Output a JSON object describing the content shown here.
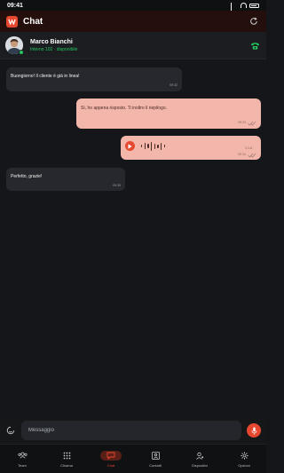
{
  "status_bar": {
    "time": "09:41"
  },
  "app_bar": {
    "title": "Chat"
  },
  "contact": {
    "name": "Marco Bianchi",
    "status": "Interno 102 · disponibile"
  },
  "messages": [
    {
      "direction": "in",
      "text": "Buongiorno! Il cliente è già in linea!",
      "time": "09:32"
    },
    {
      "direction": "out",
      "text": "Sì, ho appena risposto. Ti inoltro il riepilogo.",
      "time": "09:33"
    },
    {
      "direction": "out",
      "type": "voice",
      "duration": "0:18",
      "time": "09:34"
    },
    {
      "direction": "in",
      "text": "Perfetto, grazie!",
      "time": "09:35"
    }
  ],
  "composer": {
    "placeholder": "Messaggio"
  },
  "tabs": [
    {
      "label": "Team",
      "icon": "team-icon",
      "active": false
    },
    {
      "label": "Chiama",
      "icon": "dialpad-icon",
      "active": false
    },
    {
      "label": "Chat",
      "icon": "chat-icon",
      "active": true
    },
    {
      "label": "Contatti",
      "icon": "contacts-icon",
      "active": false
    },
    {
      "label": "Dispositivi",
      "icon": "devices-icon",
      "active": false
    },
    {
      "label": "Opzioni",
      "icon": "gear-icon",
      "active": false
    }
  ],
  "colors": {
    "accent": "#e6482f",
    "online": "#22c55e",
    "outgoing_bubble": "#f3b6aa",
    "incoming_bubble": "#26282d",
    "background": "#141619"
  }
}
